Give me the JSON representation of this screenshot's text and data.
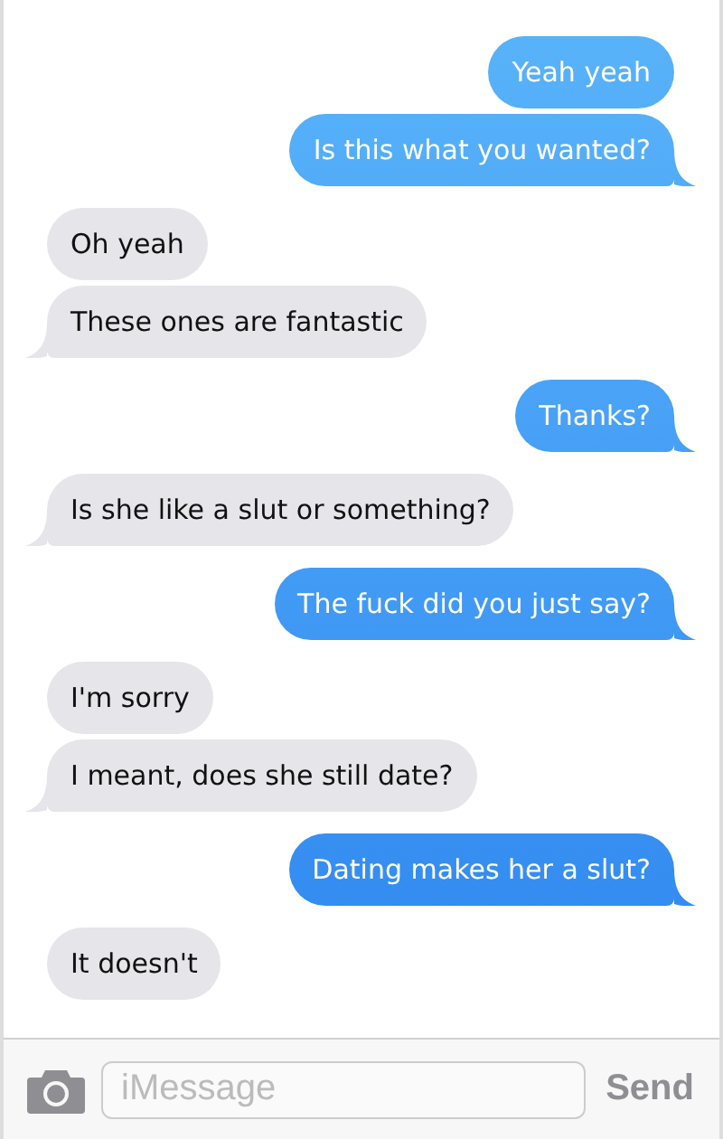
{
  "messages": [
    {
      "kind": "sent",
      "text": "Yeah yeah",
      "tail": false
    },
    {
      "kind": "sent",
      "text": "Is this what you wanted?",
      "tail": true
    },
    {
      "kind": "received",
      "text": "Oh yeah",
      "tail": false
    },
    {
      "kind": "received",
      "text": "These ones are fantastic",
      "tail": true
    },
    {
      "kind": "sent",
      "text": "Thanks?",
      "tail": true
    },
    {
      "kind": "received",
      "text": "Is she like a slut or something?",
      "tail": true
    },
    {
      "kind": "sent",
      "text": "The fuck did you just say?",
      "tail": true
    },
    {
      "kind": "received",
      "text": "I'm sorry",
      "tail": false
    },
    {
      "kind": "received",
      "text": "I meant, does she still date?",
      "tail": true
    },
    {
      "kind": "sent",
      "text": "Dating makes her a slut?",
      "tail": true
    },
    {
      "kind": "received",
      "text": "It doesn't",
      "tail": false
    }
  ],
  "composer": {
    "placeholder": "iMessage",
    "send_label": "Send"
  }
}
